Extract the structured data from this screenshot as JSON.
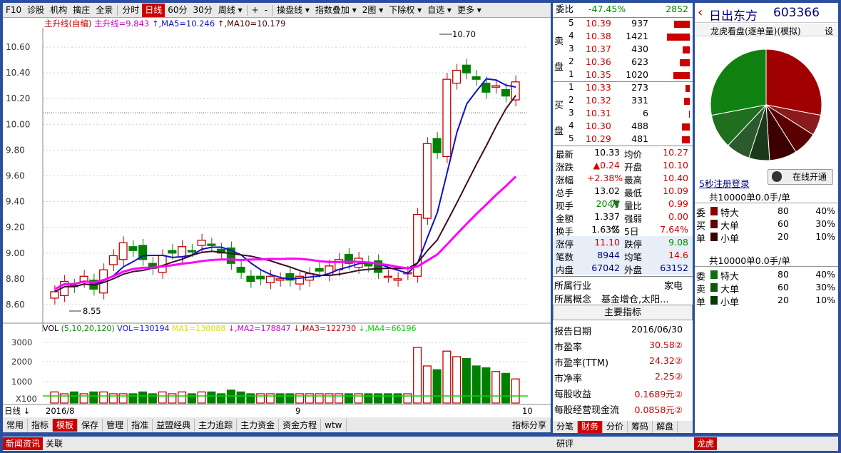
{
  "toolbar": {
    "items": [
      "F10",
      "诊股",
      "机构",
      "擒庄",
      "全景",
      "分时",
      "日线",
      "60分",
      "30分",
      "周线 ▾",
      "+",
      "-",
      "操盘线 ▾",
      "指数叠加 ▾",
      "2图 ▾",
      "下除权 ▾",
      "自选 ▾",
      "更多 ▾"
    ],
    "active": "日线"
  },
  "legend": {
    "main": "主升线(自编)",
    "ind": "主升线=9.843",
    "ma5": "MA5=10.246",
    "ma10": "MA10=10.179"
  },
  "price_axis": [
    "10.60",
    "10.40",
    "10.20",
    "10.00",
    "9.80",
    "9.60",
    "9.40",
    "9.20",
    "9.00",
    "8.80",
    "8.60"
  ],
  "price_high": "10.70",
  "price_low": "8.55",
  "vol_legend": {
    "name": "VOL",
    "params": "(5,10,20,120)",
    "vol": "VOL=130194",
    "ma1": "MA1=130088",
    "ma2": "MA2=178847",
    "ma3": "MA3=122730",
    "ma4": "MA4=66196"
  },
  "vol_axis": [
    "3000",
    "2000",
    "1000",
    "X100"
  ],
  "date_axis": {
    "start": "2016/8",
    "mid": "9",
    "end": "10",
    "mode": "日线"
  },
  "bottom_tabs": [
    "常用",
    "指标",
    "模板",
    "保存",
    "管理",
    "指准",
    "益盟经典",
    "主力追踪",
    "主力资金",
    "资金方程",
    "wtw",
    "指标分享"
  ],
  "status": [
    "新闻资讯",
    "关联",
    "龙虎"
  ],
  "quote": {
    "weibi": {
      "label": "委比",
      "pct": "-47.45%",
      "val": "2852"
    },
    "sell": [
      {
        "n": "5",
        "p": "10.39",
        "v": "937",
        "w": 22
      },
      {
        "n": "4",
        "p": "10.38",
        "v": "1421",
        "w": 32
      },
      {
        "n": "3",
        "p": "10.37",
        "v": "430",
        "w": 10
      },
      {
        "n": "2",
        "p": "10.36",
        "v": "623",
        "w": 14
      },
      {
        "n": "1",
        "p": "10.35",
        "v": "1020",
        "w": 23
      }
    ],
    "buy": [
      {
        "n": "1",
        "p": "10.33",
        "v": "273",
        "w": 6
      },
      {
        "n": "2",
        "p": "10.32",
        "v": "331",
        "w": 8
      },
      {
        "n": "3",
        "p": "10.31",
        "v": "6",
        "w": 1
      },
      {
        "n": "4",
        "p": "10.30",
        "v": "488",
        "w": 11
      },
      {
        "n": "5",
        "p": "10.29",
        "v": "481",
        "w": 11
      }
    ],
    "sell_label": [
      "卖",
      "盘"
    ],
    "buy_label": [
      "买",
      "盘"
    ],
    "stats": [
      [
        "最新",
        "10.33",
        "均价",
        "10.27"
      ],
      [
        "涨跌",
        "▲0.24",
        "开盘",
        "10.10"
      ],
      [
        "涨幅",
        "+2.38%",
        "最高",
        "10.40"
      ],
      [
        "总手",
        "13.02万",
        "最低",
        "10.09"
      ],
      [
        "现手",
        "204▼",
        "量比",
        "0.99"
      ],
      [
        "金额",
        "1.337亿",
        "强弱",
        "0.00"
      ],
      [
        "换手",
        "1.63%",
        "5日",
        "7.64%"
      ],
      [
        "涨停",
        "11.10",
        "跌停",
        "9.08"
      ],
      [
        "笔数",
        "8944",
        "均笔",
        "14.6"
      ],
      [
        "内盘",
        "67042",
        "外盘",
        "63152"
      ]
    ],
    "industry": {
      "label": "所属行业",
      "value": "家电"
    },
    "concept": {
      "label": "所属概念",
      "value": "基金增仓,太阳..."
    },
    "key_title": "主要指标",
    "key": [
      [
        "报告日期",
        "2016/06/30"
      ],
      [
        "市盈率",
        "30.58②"
      ],
      [
        "市盈率(TTM)",
        "24.32②"
      ],
      [
        "市净率",
        "2.25②"
      ],
      [
        "每股收益",
        "0.1689元②"
      ],
      [
        "每股经营现金流",
        "0.0858元②"
      ]
    ],
    "tabs": [
      "分笔",
      "财务",
      "分价",
      "筹码",
      "解盘",
      "研评"
    ]
  },
  "right": {
    "name": "日出东方",
    "code": "603366",
    "title": "龙虎看盘(逐单量)(模拟)",
    "setting": "设",
    "register": "5秒注册登录",
    "open": "在线开通",
    "pie": [
      {
        "v": 0.28,
        "c": "#a00000"
      },
      {
        "v": 0.06,
        "c": "#8b1a1a"
      },
      {
        "v": 0.07,
        "c": "#5a0000"
      },
      {
        "v": 0.08,
        "c": "#3d0000"
      },
      {
        "v": 0.06,
        "c": "#1a3a1a"
      },
      {
        "v": 0.07,
        "c": "#2d5a2d"
      },
      {
        "v": 0.1,
        "c": "#1f6f1f"
      },
      {
        "v": 0.28,
        "c": "#108010"
      }
    ],
    "sec1": {
      "head": "共10000单0.0手/单",
      "side": [
        "委",
        "买",
        "单"
      ],
      "rows": [
        [
          "特大",
          "80",
          "40%",
          "#8b0000"
        ],
        [
          "大单",
          "60",
          "30%",
          "#600000"
        ],
        [
          "小单",
          "20",
          "10%",
          "#3a0000"
        ]
      ]
    },
    "sec2": {
      "head": "共10000单0.0手/单",
      "side": [
        "委",
        "卖",
        "单"
      ],
      "rows": [
        [
          "特大",
          "80",
          "40%",
          "#107010"
        ],
        [
          "大单",
          "60",
          "30%",
          "#0a5a0a"
        ],
        [
          "小单",
          "20",
          "10%",
          "#063806"
        ]
      ]
    }
  },
  "colors": {
    "up": "#c00000",
    "down": "#008000",
    "ma5": "#1010c8",
    "ma10": "#400a2a",
    "magenta": "#ff00ff",
    "grid": "#9ab"
  }
}
